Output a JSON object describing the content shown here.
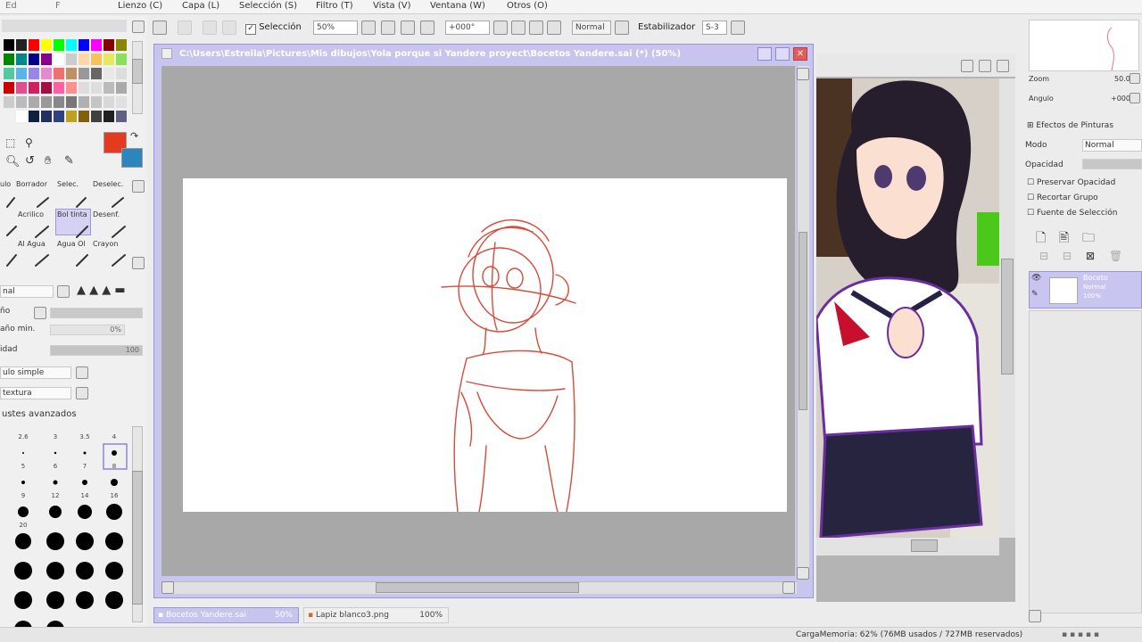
{
  "menu": [
    "Lienzo (C)",
    "Capa (L)",
    "Selección (S)",
    "Filtro (T)",
    "Vista (V)",
    "Ventana (W)",
    "Otros (O)"
  ],
  "toolbar": {
    "selection_label": "Selección",
    "zoom_value": "50%",
    "rotation_value": "+000°",
    "blend_mode": "Normal",
    "stabilizer_label": "Estabilizador",
    "stabilizer_value": "S-3"
  },
  "tools_panel": {
    "brush_tools_row1": [
      "Borrador",
      "Selec.",
      "Deselec."
    ],
    "brush_tools_row2": [
      "Acrilico",
      "Bol tinta",
      "Desenf."
    ],
    "brush_tools_row3": [
      "Al Agua",
      "Agua Ol",
      "Crayon"
    ],
    "min_size_label": "año min.",
    "min_size_value": "0%",
    "density_label": "idad",
    "density_value": "100",
    "shape_dropdown": "ulo simple",
    "texture_dropdown": "textura",
    "advanced_label": "ustes avanzados",
    "size_labels": [
      "2.6",
      "3",
      "3.5",
      "4",
      "5",
      "6",
      "7",
      "8",
      "9",
      "12",
      "14",
      "16",
      "20"
    ]
  },
  "document": {
    "title": "C:\\Users\\Estrella\\Pictures\\Mis dibujos\\Yola porque si Yandere proyect\\Bocetos Yandere.sai (*) (50%)",
    "colors": {
      "title_bg": "#c7c4f0",
      "canvas_bg": "#a8a8a8",
      "sketch": "#d84a3a"
    }
  },
  "navigator": {
    "zoom_label": "Zoom",
    "zoom_value": "50.0%",
    "angle_label": "Angulo",
    "angle_value": "+000$"
  },
  "layer_panel": {
    "paint_effects_label": "Efectos de Pinturas",
    "mode_label": "Modo",
    "mode_value": "Normal",
    "opacity_label": "Opacidad",
    "preserve_opacity": "Preservar Opacidad",
    "clip_group": "Recortar Grupo",
    "selection_source": "Fuente de Selección",
    "layers": [
      {
        "name": "Boceto",
        "mode": "Normal",
        "opacity": "100%"
      }
    ]
  },
  "tabs": [
    {
      "name": "Bocetos Yandere.sai",
      "zoom": "50%"
    },
    {
      "name": "Lapiz blanco3.png",
      "zoom": "100%"
    }
  ],
  "status": {
    "memory": "CargaMemoria: 62% (76MB usados / 727MB reservados)"
  }
}
